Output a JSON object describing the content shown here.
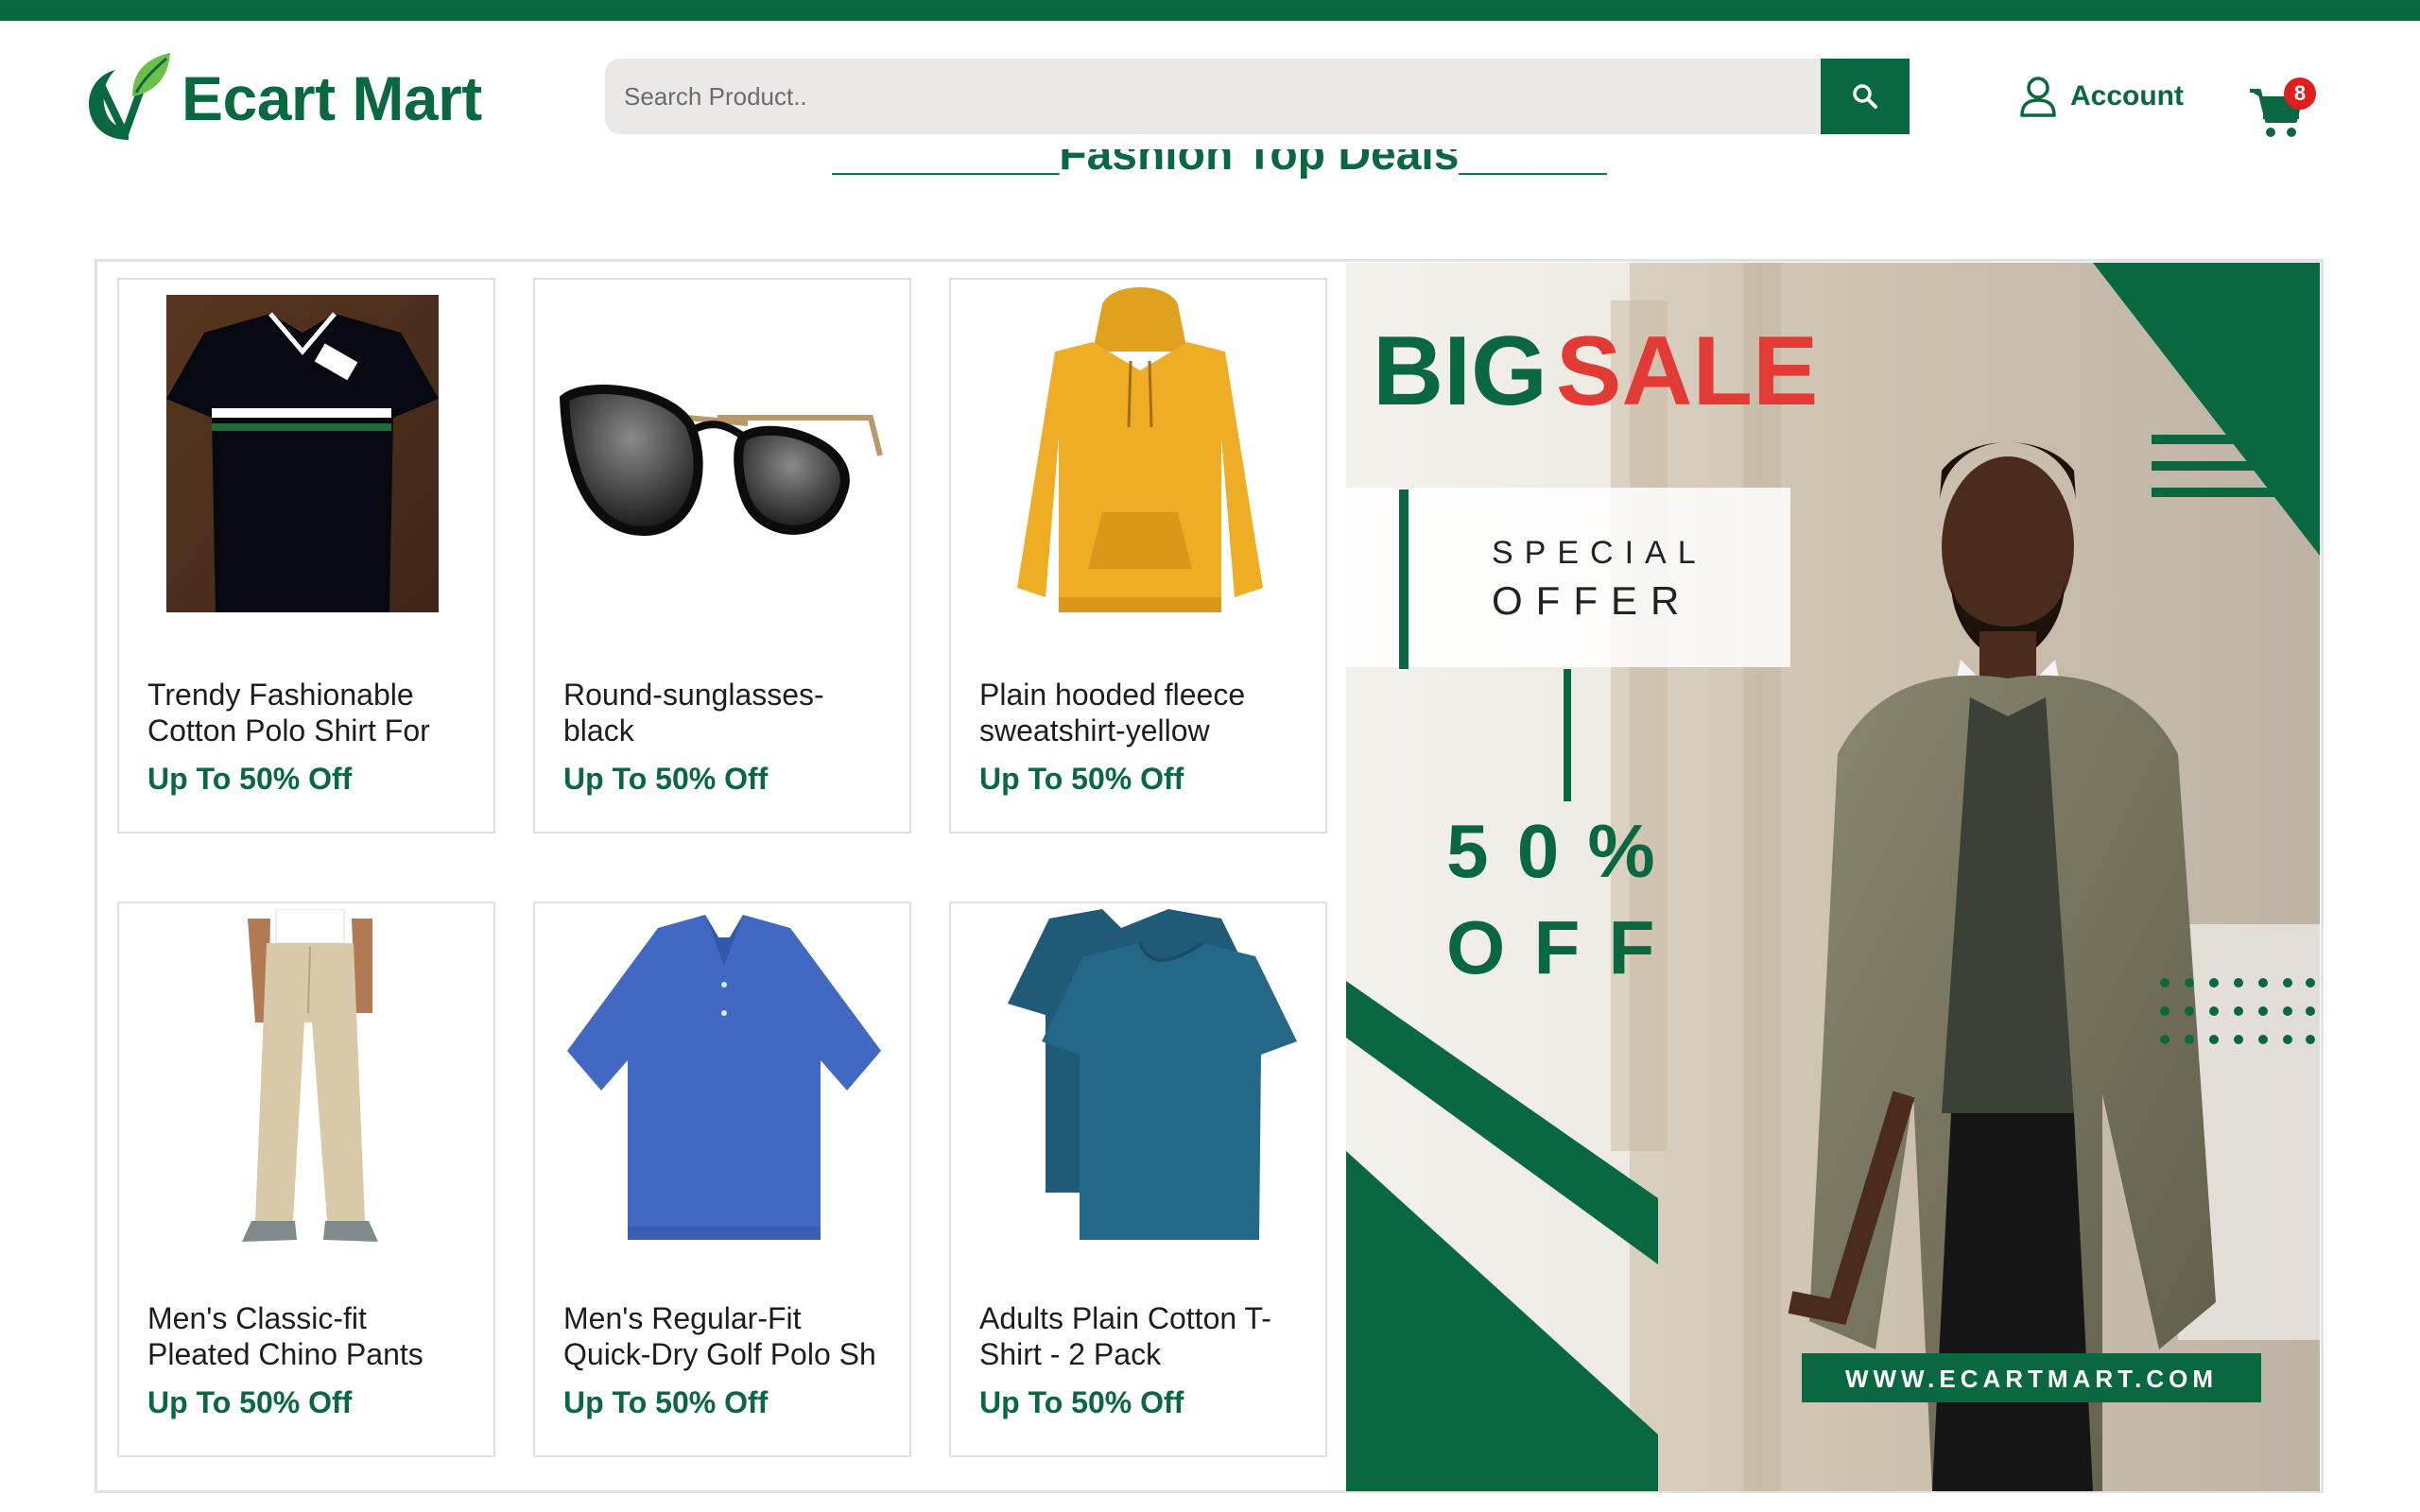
{
  "header": {
    "brand": "Ecart Mart",
    "search_placeholder": "Search Product..",
    "account_label": "Account",
    "cart_count": "8"
  },
  "section": {
    "title": "_________Fashion Top Deals_________"
  },
  "products": [
    {
      "name": "Trendy Fashionable Cotton Polo Shirt For",
      "deal": "Up To 50% Off",
      "image_icon": "black-polo-shirt"
    },
    {
      "name": "Round-sunglasses-black",
      "deal": "Up To 50% Off",
      "image_icon": "sunglasses"
    },
    {
      "name": "Plain hooded fleece sweatshirt-yellow",
      "deal": "Up To 50% Off",
      "image_icon": "yellow-hoodie"
    },
    {
      "name": "Men's Classic-fit Pleated Chino Pants",
      "deal": "Up To 50% Off",
      "image_icon": "khaki-chino-pants"
    },
    {
      "name": "Men's Regular-Fit Quick-Dry Golf Polo Sh",
      "deal": "Up To 50% Off",
      "image_icon": "blue-polo-shirt"
    },
    {
      "name": "Adults Plain Cotton T-Shirt - 2 Pack",
      "deal": "Up To 50% Off",
      "image_icon": "teal-tshirts"
    }
  ],
  "banner": {
    "big": "BIG",
    "sale": "SALE",
    "special": "SPECIAL",
    "offer": "OFFER",
    "percent": "5 0 %",
    "off": "O F F",
    "url": "WWW.ECARTMART.COM"
  },
  "colors": {
    "brand_green": "#0a6841",
    "sale_red": "#e23a34",
    "badge_red": "#e01e1e",
    "search_bg": "#ebe8e8"
  }
}
